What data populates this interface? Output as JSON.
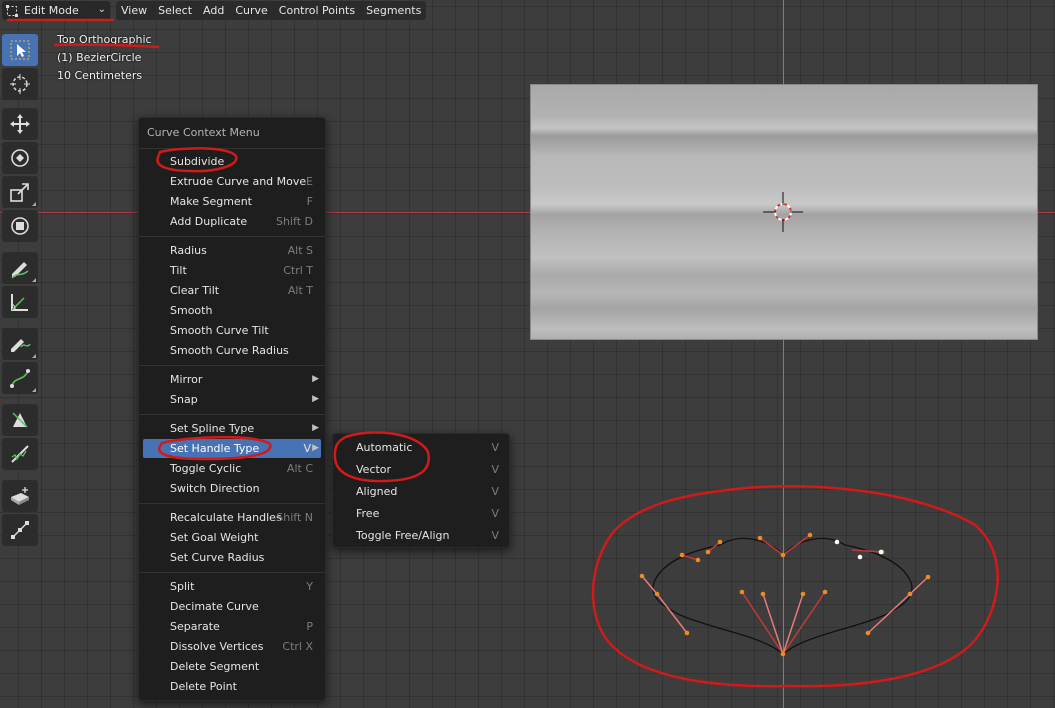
{
  "header": {
    "mode": "Edit Mode",
    "menus": [
      "View",
      "Select",
      "Add",
      "Curve",
      "Control Points",
      "Segments"
    ]
  },
  "viewport_info": {
    "view_name": "Top Orthographic",
    "object_name": "(1) BezierCircle",
    "scale": "10 Centimeters"
  },
  "toolbar": {
    "tools": [
      {
        "name": "select-box-icon"
      },
      {
        "name": "cursor-icon"
      },
      {
        "name": "move-icon"
      },
      {
        "name": "rotate-icon"
      },
      {
        "name": "scale-icon"
      },
      {
        "name": "transform-icon"
      },
      {
        "name": "annotate-icon"
      },
      {
        "name": "measure-icon"
      },
      {
        "name": "draw-icon"
      },
      {
        "name": "curve-pen-icon"
      },
      {
        "name": "tilt-icon"
      },
      {
        "name": "randomize-icon"
      },
      {
        "name": "extrude-icon"
      },
      {
        "name": "radius-icon"
      }
    ]
  },
  "context_menu": {
    "title": "Curve Context Menu",
    "items": [
      {
        "label": "Subdivide",
        "shortcut": ""
      },
      {
        "label": "Extrude Curve and Move",
        "shortcut": "E"
      },
      {
        "label": "Make Segment",
        "shortcut": "F"
      },
      {
        "label": "Add Duplicate",
        "shortcut": "Shift D"
      },
      {
        "label": "Radius",
        "shortcut": "Alt S"
      },
      {
        "label": "Tilt",
        "shortcut": "Ctrl T"
      },
      {
        "label": "Clear Tilt",
        "shortcut": "Alt T"
      },
      {
        "label": "Smooth",
        "shortcut": ""
      },
      {
        "label": "Smooth Curve Tilt",
        "shortcut": ""
      },
      {
        "label": "Smooth Curve Radius",
        "shortcut": ""
      },
      {
        "label": "Mirror",
        "shortcut": ""
      },
      {
        "label": "Snap",
        "shortcut": ""
      },
      {
        "label": "Set Spline Type",
        "shortcut": ""
      },
      {
        "label": "Set Handle Type",
        "shortcut": "V"
      },
      {
        "label": "Toggle Cyclic",
        "shortcut": "Alt C"
      },
      {
        "label": "Switch Direction",
        "shortcut": ""
      },
      {
        "label": "Recalculate Handles",
        "shortcut": "Shift N"
      },
      {
        "label": "Set Goal Weight",
        "shortcut": ""
      },
      {
        "label": "Set Curve Radius",
        "shortcut": ""
      },
      {
        "label": "Split",
        "shortcut": "Y"
      },
      {
        "label": "Decimate Curve",
        "shortcut": ""
      },
      {
        "label": "Separate",
        "shortcut": "P"
      },
      {
        "label": "Dissolve Vertices",
        "shortcut": "Ctrl X"
      },
      {
        "label": "Delete Segment",
        "shortcut": ""
      },
      {
        "label": "Delete Point",
        "shortcut": ""
      }
    ]
  },
  "handle_submenu": {
    "items": [
      {
        "label": "Automatic",
        "shortcut": "V"
      },
      {
        "label": "Vector",
        "shortcut": "V"
      },
      {
        "label": "Aligned",
        "shortcut": "V"
      },
      {
        "label": "Free",
        "shortcut": "V"
      },
      {
        "label": "Toggle Free/Align",
        "shortcut": "V"
      }
    ]
  },
  "colors": {
    "accent": "#4772b3",
    "annotation": "#d11a1a",
    "x_axis": "#a6404c",
    "y_axis": "#6a9a2a",
    "control_point": "#f08a24"
  }
}
